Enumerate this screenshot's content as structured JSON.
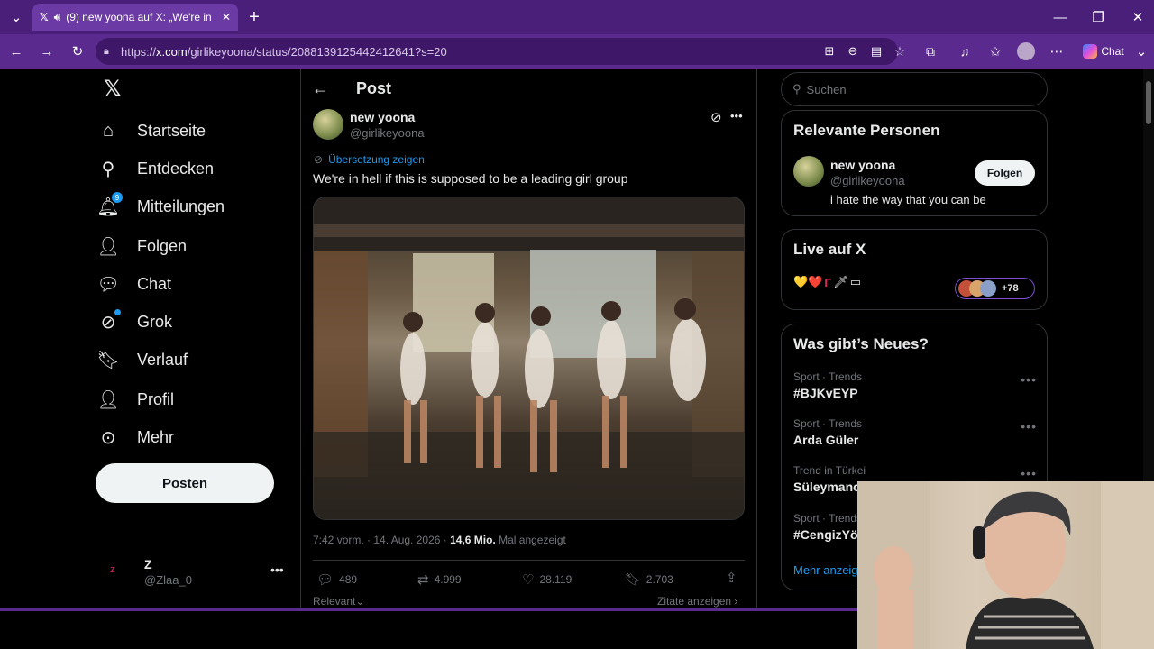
{
  "browser": {
    "tab_title": "(9) new yoona auf X: „We're in",
    "url_prefix": "https://",
    "url_host": "x.com",
    "url_path": "/girlikeyoona/status/2088139125442412641?s=20",
    "chat_label": "Chat"
  },
  "nav": {
    "items": [
      {
        "label": "Startseite",
        "icon": "home-icon"
      },
      {
        "label": "Entdecken",
        "icon": "search-icon"
      },
      {
        "label": "Mitteilungen",
        "icon": "bell-icon",
        "badge": "9"
      },
      {
        "label": "Folgen",
        "icon": "follow-icon"
      },
      {
        "label": "Chat",
        "icon": "chat-icon"
      },
      {
        "label": "Grok",
        "icon": "grok-icon"
      },
      {
        "label": "Verlauf",
        "icon": "bookmark-icon"
      },
      {
        "label": "Profil",
        "icon": "profile-icon"
      },
      {
        "label": "Mehr",
        "icon": "more-icon"
      }
    ],
    "post_button": "Posten",
    "account_name": "Z",
    "account_handle": "@Zlaa_0"
  },
  "post": {
    "header": "Post",
    "author_name": "new yoona",
    "author_handle": "@girlikeyoona",
    "translate_label": "Übersetzung zeigen",
    "text": "We're in hell if this is supposed to be a leading girl group",
    "timestamp": "7:42 vorm. · 14. Aug. 2026 · ",
    "views": "14,6 Mio.",
    "views_label": " Mal angezeigt",
    "replies": "489",
    "reposts": "4.999",
    "likes": "28.119",
    "bookmarks": "2.703",
    "sort_label": "Relevant",
    "quotes_label": "Zitate anzeigen"
  },
  "sidebar": {
    "search_placeholder": "Suchen",
    "relevant_title": "Relevante Personen",
    "relevant_name": "new yoona",
    "relevant_handle": "@girlikeyoona",
    "relevant_bio": "i hate the way that you can be",
    "follow_label": "Folgen",
    "live_title": "Live auf X",
    "live_emojis": "💛❤️",
    "live_more": "+78",
    "trends_title": "Was gibt’s Neues?",
    "trends": [
      {
        "category": "Sport · Trends",
        "name": "#BJKvEYP"
      },
      {
        "category": "Sport · Trends",
        "name": "Arda Güler"
      },
      {
        "category": "Trend in Türkei",
        "name": "Süleymancı"
      },
      {
        "category": "Sport · Trends",
        "name": "#CengizYön"
      }
    ],
    "show_more": "Mehr anzeig"
  },
  "colors": {
    "accent": "#1d9bf0",
    "browser_frame": "#5a2a8e",
    "border": "#2f3336"
  }
}
